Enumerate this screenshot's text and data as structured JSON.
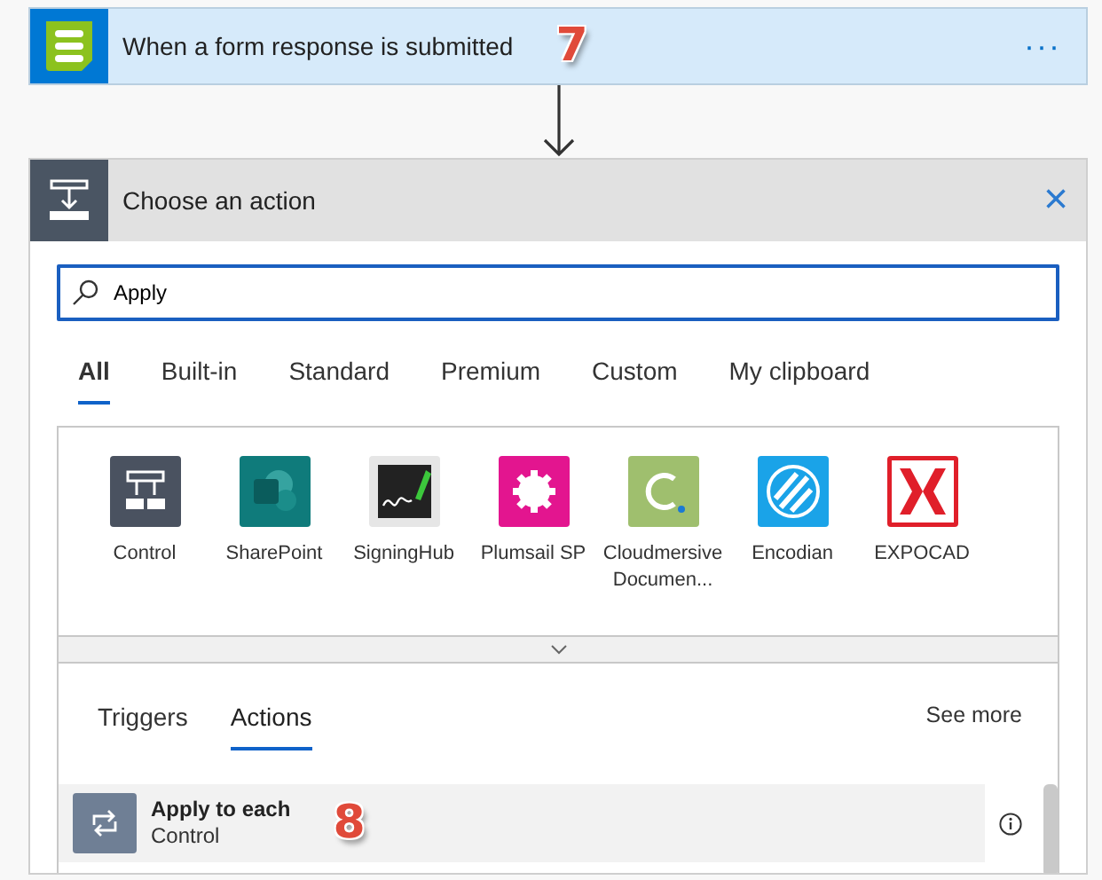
{
  "trigger": {
    "title": "When a form response is submitted",
    "step_badge": "7",
    "menu": "···"
  },
  "action_panel": {
    "title": "Choose an action",
    "close": "×"
  },
  "search": {
    "value": "Apply"
  },
  "filter_tabs": [
    {
      "label": "All",
      "selected": true
    },
    {
      "label": "Built-in",
      "selected": false
    },
    {
      "label": "Standard",
      "selected": false
    },
    {
      "label": "Premium",
      "selected": false
    },
    {
      "label": "Custom",
      "selected": false
    },
    {
      "label": "My clipboard",
      "selected": false
    }
  ],
  "connectors": [
    {
      "name": "Control",
      "color": "#4a5260"
    },
    {
      "name": "SharePoint",
      "color": "#0f7b7b"
    },
    {
      "name": "SigningHub",
      "color": "#e6e6e6"
    },
    {
      "name": "Plumsail SP",
      "color": "#e3158f"
    },
    {
      "name": "Cloudmersive Documen...",
      "color": "#9fbf6e"
    },
    {
      "name": "Encodian",
      "color": "#1aa3e8"
    },
    {
      "name": "EXPOCAD",
      "color": "#e01f2a"
    }
  ],
  "result_tabs": [
    {
      "label": "Triggers",
      "selected": false
    },
    {
      "label": "Actions",
      "selected": true
    }
  ],
  "see_more": "See more",
  "results": [
    {
      "title": "Apply to each",
      "subtitle": "Control",
      "step_badge": "8"
    }
  ]
}
